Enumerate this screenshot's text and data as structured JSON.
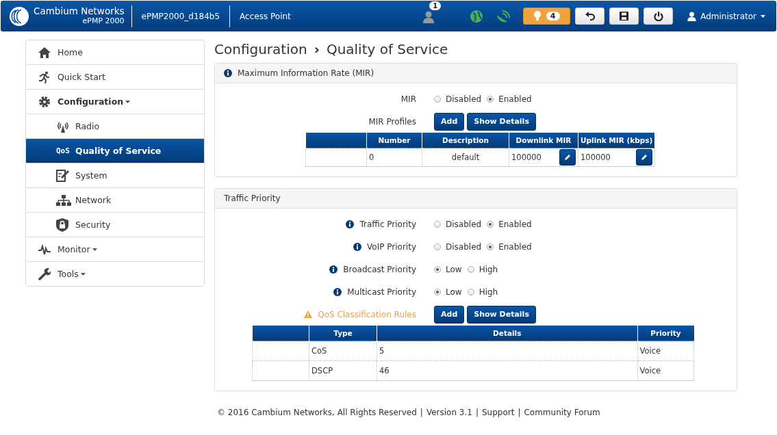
{
  "header": {
    "brand": "Cambium Networks",
    "model": "ePMP 2000",
    "device": "ePMP2000_d184b5",
    "mode": "Access Point",
    "users_count": "1",
    "alerts_count": "4",
    "user": "Administrator"
  },
  "sidebar": {
    "items": [
      {
        "label": "Home",
        "selected": false
      },
      {
        "label": "Quick Start",
        "selected": false
      },
      {
        "label": "Configuration",
        "selected": false,
        "expanded": true,
        "children": [
          {
            "label": "Radio",
            "selected": false
          },
          {
            "label": "Quality of Service",
            "selected": true,
            "icon_text": "QoS"
          },
          {
            "label": "System",
            "selected": false
          },
          {
            "label": "Network",
            "selected": false
          },
          {
            "label": "Security",
            "selected": false
          }
        ]
      },
      {
        "label": "Monitor",
        "selected": false,
        "expanded": false
      },
      {
        "label": "Tools",
        "selected": false,
        "expanded": false
      }
    ]
  },
  "breadcrumb": {
    "parent": "Configuration",
    "separator": "›",
    "current": "Quality of Service"
  },
  "mir_panel": {
    "title": "Maximum Information Rate (MIR)",
    "fields": [
      {
        "label": "MIR",
        "options": [
          {
            "label": "Disabled",
            "selected": false
          },
          {
            "label": "Enabled",
            "selected": true
          }
        ]
      }
    ],
    "profiles_label": "MIR Profiles",
    "buttons": [
      "Add",
      "Show Details"
    ],
    "table": {
      "columns": [
        {
          "label": "Number",
          "editable": false
        },
        {
          "label": "Description",
          "editable": false
        },
        {
          "label": "Downlink MIR",
          "editable": true
        },
        {
          "label": "Uplink MIR (kbps)",
          "editable": true
        }
      ],
      "rows": [
        {
          "cells": [
            "0",
            "default",
            "100000",
            "100000"
          ]
        }
      ]
    }
  },
  "traffic_panel": {
    "title": "Traffic Priority",
    "fields": [
      {
        "label": "Traffic Priority",
        "options": [
          {
            "label": "Disabled",
            "selected": false
          },
          {
            "label": "Enabled",
            "selected": true
          }
        ]
      },
      {
        "label": "VoIP Priority",
        "options": [
          {
            "label": "Disabled",
            "selected": false
          },
          {
            "label": "Enabled",
            "selected": true
          }
        ]
      },
      {
        "label": "Broadcast Priority",
        "options": [
          {
            "label": "Low",
            "selected": true
          },
          {
            "label": "High",
            "selected": false
          }
        ]
      },
      {
        "label": "Multicast Priority",
        "options": [
          {
            "label": "Low",
            "selected": true
          },
          {
            "label": "High",
            "selected": false
          }
        ]
      }
    ],
    "rules_label": "QoS Classification Rules",
    "buttons": [
      "Add",
      "Show Details"
    ],
    "table": {
      "columns": [
        {
          "label": "Type"
        },
        {
          "label": "Details"
        },
        {
          "label": "Priority"
        }
      ],
      "rows": [
        {
          "cells": [
            "CoS",
            "5",
            "Voice"
          ]
        },
        {
          "cells": [
            "DSCP",
            "46",
            "Voice"
          ]
        }
      ]
    }
  },
  "footer": {
    "separator": "|",
    "items": [
      "© 2016 Cambium Networks, All Rights Reserved",
      "Version 3.1",
      "Support",
      "Community Forum"
    ]
  }
}
